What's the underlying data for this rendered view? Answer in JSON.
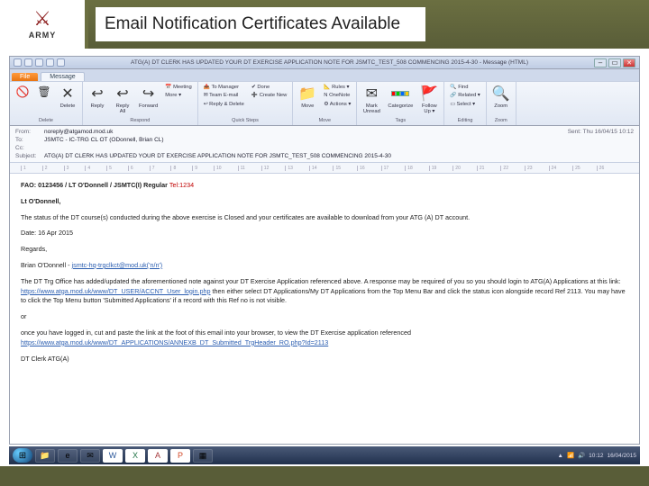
{
  "slide": {
    "badge_text": "ARMY",
    "title": "Email Notification Certificates Available"
  },
  "outlook": {
    "window_title": "ATG(A) DT CLERK HAS UPDATED YOUR DT EXERCISE APPLICATION NOTE FOR JSMTC_TEST_508 COMMENCING 2015-4-30 - Message (HTML)",
    "file_tab": "File",
    "tab_message": "Message",
    "ribbon": {
      "delete": {
        "x": "✕",
        "delete": "Delete",
        "label": "Delete"
      },
      "respond": {
        "reply": "Reply",
        "reply_all": "Reply\nAll",
        "forward": "Forward",
        "meeting": "📅 Meeting",
        "more": "More ▾",
        "label": "Respond"
      },
      "quick": {
        "to_manager": "📤 To Manager",
        "team_email": "✉ Team E-mail",
        "reply_delete": "↩ Reply & Delete",
        "done": "✔ Done",
        "create_new": "➕ Create New",
        "label": "Quick Steps"
      },
      "move": {
        "move": "Move",
        "rules": "📐 Rules ▾",
        "onenote": "N OneNote",
        "actions": "⚙ Actions ▾",
        "label": "Move"
      },
      "tags": {
        "unread": "Mark\nUnread",
        "categorize": "Categorize",
        "followup": "Follow\nUp ▾",
        "label": "Tags"
      },
      "editing": {
        "find": "🔍 Find",
        "related": "🔗 Related ▾",
        "select": "▭ Select ▾",
        "label": "Editing"
      },
      "zoom": {
        "zoom": "Zoom",
        "label": "Zoom"
      }
    },
    "headers": {
      "from_lbl": "From:",
      "from_val": "noreply@atgamod.mod.uk",
      "to_lbl": "To:",
      "to_val": "JSMTC - IC-TRG CL OT (ODonnell, Brian CL)",
      "cc_lbl": "Cc:",
      "cc_val": "",
      "subj_lbl": "Subject:",
      "subj_val": "ATG(A) DT CLERK HAS UPDATED YOUR DT EXERCISE APPLICATION NOTE FOR JSMTC_TEST_508 COMMENCING 2015-4-30",
      "sent_lbl": "Sent:",
      "sent_val": "Thu 16/04/15 10:12"
    }
  },
  "message": {
    "fao_prefix": "FAO: 0123456 / LT O'Donnell / JSMTC(I)  Regular  ",
    "fao_tel": "Tel:1234",
    "salutation": "Lt O'Donnell,",
    "status_line": "The status of the DT course(s) conducted during the above exercise is Closed and your certificates are available to download from your ATG (A) DT account.",
    "date_line": "Date: 16 Apr 2015",
    "regards": "Regards,",
    "signer_name": "Brian O'Donnell - ",
    "signer_email": "jsmtc-hq-trgclkct@mod.uk('n/n')",
    "para_pre": "The DT Trg Office has added/updated the aforementioned note against your DT Exercise Application referenced above. A response may be required of you so you should login to ATG(A) Applications at this link: ",
    "para_link1": "https://www.atga.mod.uk/www/DT_USER/ACCNT_User_login.php",
    "para_mid": " then either select DT Applications/My DT Applications from the Top Menu Bar and click the status icon alongside record Ref 2113. You may have to click the Top Menu button 'Submitted Applications' if a record with this Ref no is not visible.",
    "or": "or",
    "para2_pre": "once you have logged in, cut and paste the link at the foot of this email into your browser, to view the DT Exercise application referenced ",
    "para2_link": "https://www.atga.mod.uk/www/DT_APPLICATIONS/ANNEXB_DT_Submitted_TrgHeader_RO.php?Id=2113",
    "clerk": "DT Clerk  ATG(A)"
  },
  "taskbar": {
    "clock": "10:12",
    "date": "16/04/2015"
  }
}
